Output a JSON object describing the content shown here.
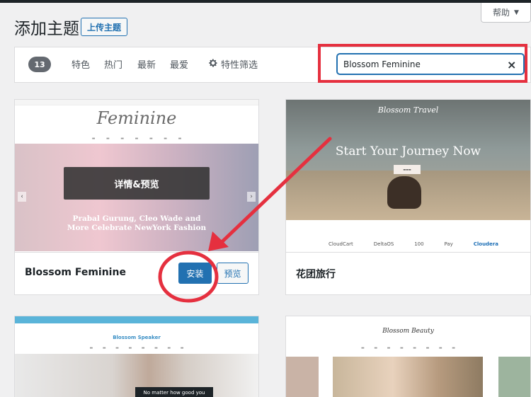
{
  "header": {
    "title": "添加主题",
    "upload_label": "上传主题",
    "help_label": "帮助"
  },
  "filter_bar": {
    "count": "13",
    "tabs": [
      "特色",
      "热门",
      "最新",
      "最爱"
    ],
    "feature_filter_label": "特性筛选"
  },
  "search": {
    "value": "Blossom Feminine"
  },
  "themes": [
    {
      "name": "Blossom Feminine",
      "overlay_label": "详情&预览",
      "install_label": "安装",
      "preview_label": "预览",
      "screenshot": {
        "logo": "Feminine",
        "headline_line1": "Prabal Gurung, Cleo Wade and",
        "headline_line2": "More Celebrate NewYork Fashion"
      }
    },
    {
      "name": "花团旅行",
      "screenshot": {
        "logo": "Blossom Travel",
        "headline": "Start Your Journey Now",
        "logos": [
          "CloudCart",
          "DeltaOS",
          "100",
          "Pay",
          "Cloudera"
        ]
      }
    },
    {
      "name": "",
      "screenshot": {
        "logo": "Blossom Speaker",
        "caption": "No matter how good you"
      }
    },
    {
      "name": "",
      "screenshot": {
        "logo": "Blossom Beauty"
      }
    }
  ],
  "colors": {
    "accent": "#2271b1",
    "annotation_red": "#e5303f",
    "admin_bar": "#1d2327"
  }
}
